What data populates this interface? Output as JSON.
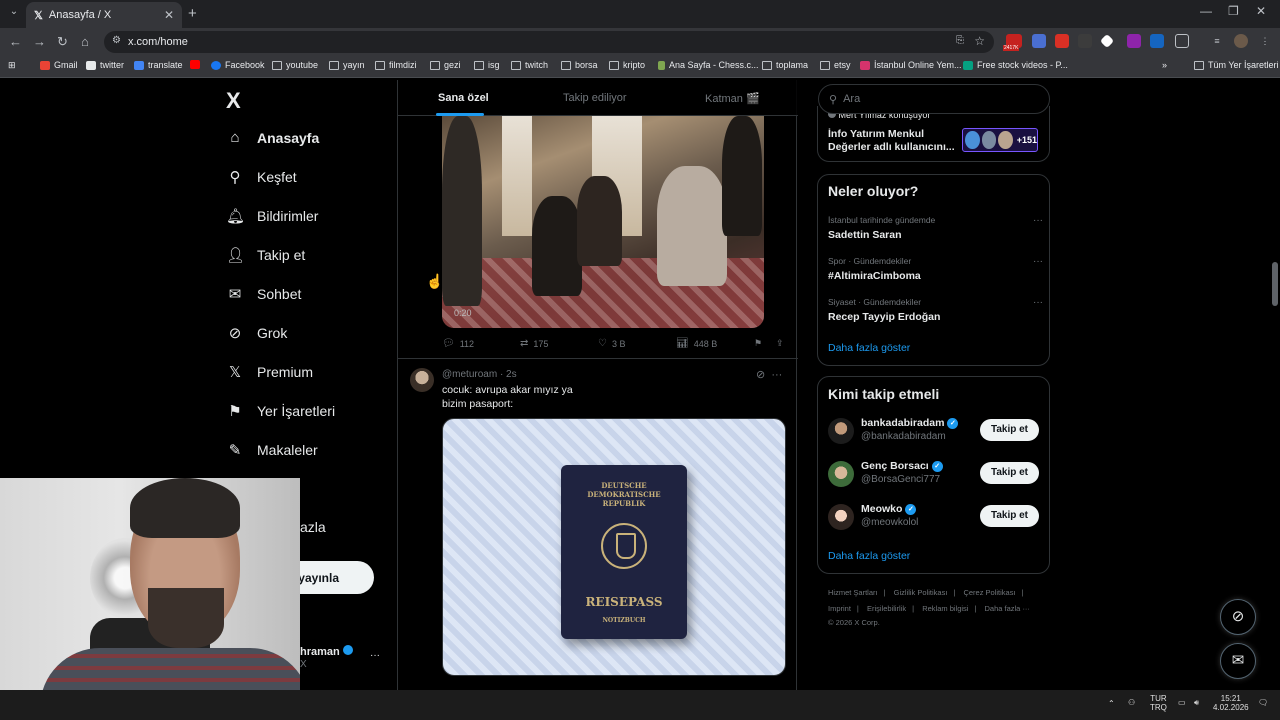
{
  "browser": {
    "tab_title": "Anasayfa / X",
    "tab_close": "✕",
    "new_tab": "+",
    "url": "x.com/home",
    "ext_badge": "2417K",
    "bookmarks": [
      "Gmail",
      "twitter",
      "translate",
      "Facebook",
      "youtube",
      "yayın",
      "filmdizi",
      "gezi",
      "isg",
      "twitch",
      "borsa",
      "kripto",
      "Ana Sayfa - Chess.c...",
      "toplama",
      "etsy",
      "İstanbul Online Yem...",
      "Free stock videos - P..."
    ],
    "bookmarks_overflow": "»",
    "all_bookmarks": "Tüm Yer İşaretleri"
  },
  "nav": {
    "logo": "X",
    "items": [
      {
        "label": "Anasayfa",
        "icon": "home-icon"
      },
      {
        "label": "Keşfet",
        "icon": "search-icon"
      },
      {
        "label": "Bildirimler",
        "icon": "bell-icon"
      },
      {
        "label": "Takip et",
        "icon": "person-add-icon"
      },
      {
        "label": "Sohbet",
        "icon": "mail-icon"
      },
      {
        "label": "Grok",
        "icon": "grok-icon"
      },
      {
        "label": "Premium",
        "icon": "x-icon"
      },
      {
        "label": "Yer İşaretleri",
        "icon": "bookmark-icon"
      },
      {
        "label": "Makaleler",
        "icon": "article-icon"
      }
    ],
    "more_fragment": "azla",
    "post_fragment": "yayınla",
    "profile_fragment": "hraman",
    "profile_handle_fragment": "X",
    "profile_more": "···"
  },
  "feed": {
    "tabs": [
      "Sana özel",
      "Takip ediliyor",
      "Katman 🎬"
    ],
    "video_timestamp": "0:20",
    "tweet1_stats": {
      "replies": "112",
      "reposts": "175",
      "likes": "3 B",
      "views": "448 B"
    },
    "tweet2": {
      "handle": "@meturoam · 2s",
      "text_line1": "cocuk: avrupa akar mıyız ya",
      "text_line2": "bizim pasaport:",
      "passport_line1": "DEUTSCHE",
      "passport_line2": "DEMOKRATISCHE",
      "passport_line3": "REPUBLIK",
      "passport_title": "REISEPASS",
      "passport_sub": "NOTIZBUCH"
    }
  },
  "right": {
    "search_placeholder": "Ara",
    "space": {
      "host": "Mert Yılmaz konuşuyor",
      "title": "İnfo Yatırım Menkul Değerler adlı kullanıcını...",
      "count": "+151"
    },
    "trends_title": "Neler oluyor?",
    "trends": [
      {
        "category": "İstanbul tarihinde gündemde",
        "name": "Sadettin Saran"
      },
      {
        "category": "Spor · Gündemdekiler",
        "name": "#AltimiraCimboma"
      },
      {
        "category": "Siyaset · Gündemdekiler",
        "name": "Recep Tayyip Erdoğan"
      }
    ],
    "show_more": "Daha fazla göster",
    "follow_title": "Kimi takip etmeli",
    "follow": [
      {
        "name": "bankadabiradam",
        "handle": "@bankadabiradam"
      },
      {
        "name": "Genç Borsacı",
        "handle": "@BorsaGenci777"
      },
      {
        "name": "Meowko",
        "handle": "@meowkolol"
      }
    ],
    "follow_button": "Takip et",
    "footer_row1": [
      "Hizmet Şartları",
      "Gizlilik Politikası",
      "Çerez Politikası"
    ],
    "footer_row2": [
      "Imprint",
      "Erişilebilirlik",
      "Reklam bilgisi",
      "Daha fazla ···"
    ],
    "copyright": "© 2026 X Corp."
  },
  "taskbar": {
    "lang_line1": "TUR",
    "lang_line2": "TRQ",
    "time": "15:21",
    "date": "4.02.2026"
  }
}
